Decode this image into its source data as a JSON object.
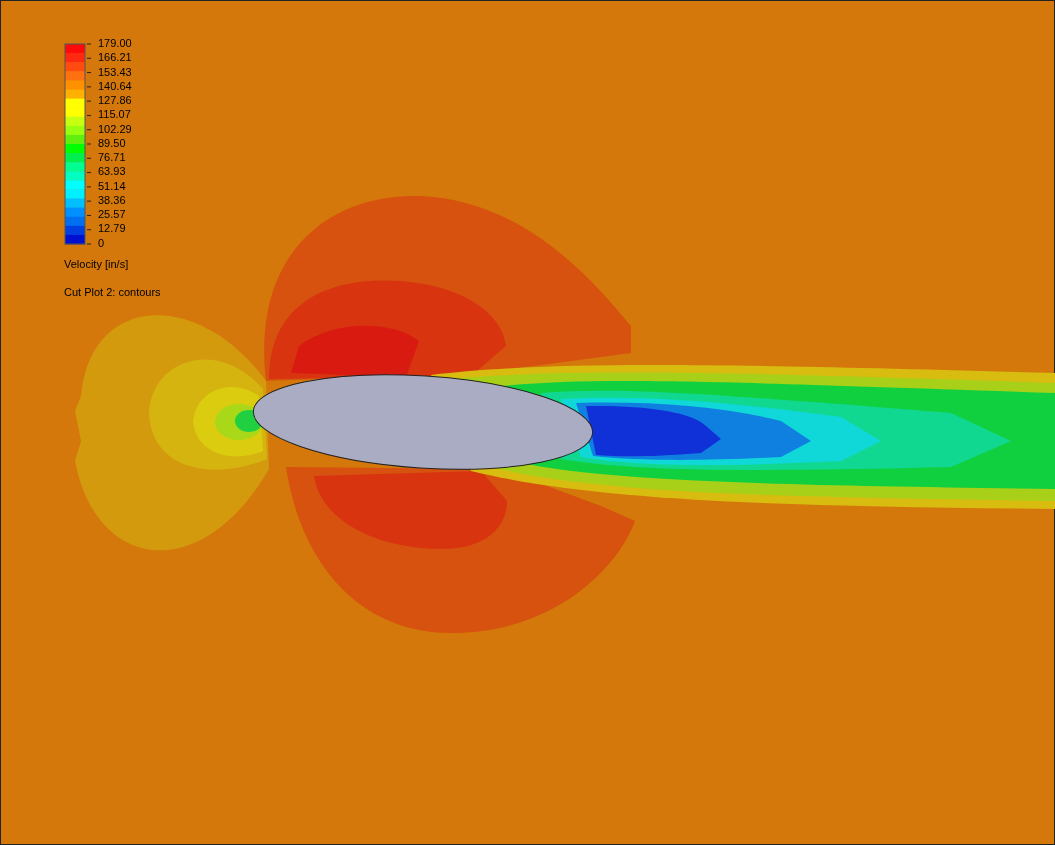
{
  "legend": {
    "ticks": [
      "179.00",
      "166.21",
      "153.43",
      "140.64",
      "127.86",
      "115.07",
      "102.29",
      "89.50",
      "76.71",
      "63.93",
      "51.14",
      "38.36",
      "25.57",
      "12.79",
      "0"
    ],
    "quantity": "Velocity [in/s]"
  },
  "plot_caption": "Cut Plot 2: contours"
}
